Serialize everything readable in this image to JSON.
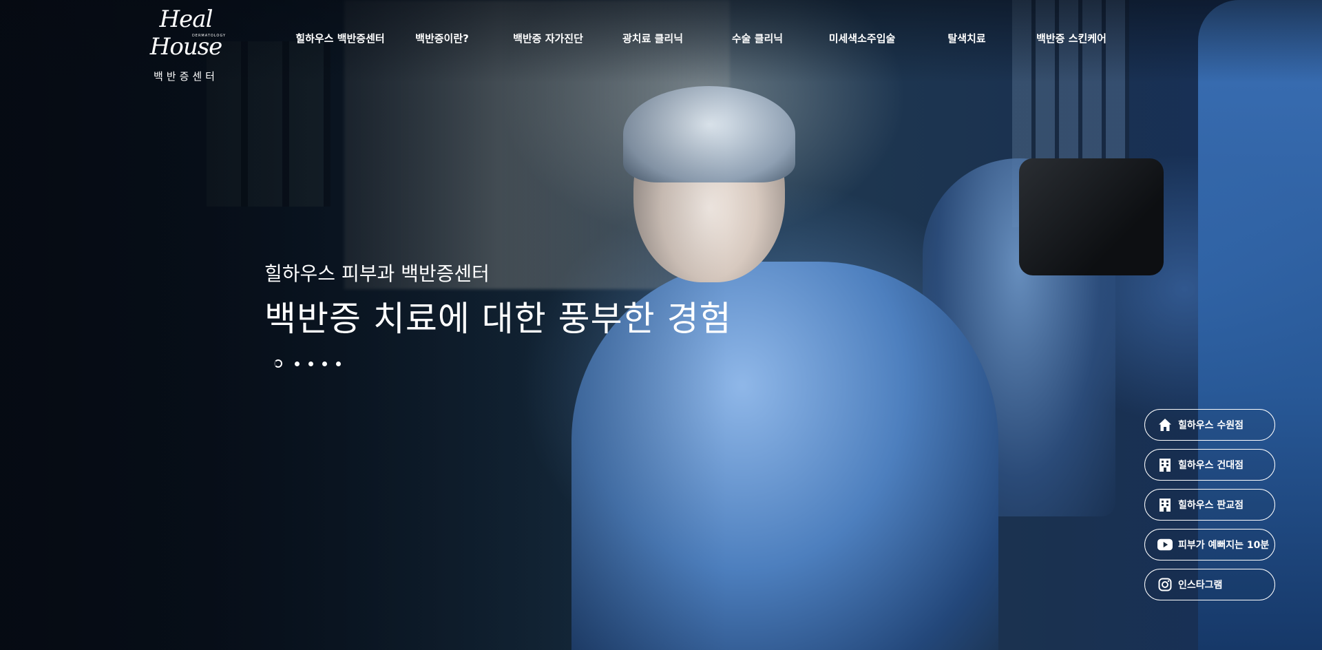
{
  "logo": {
    "script": "Heal House",
    "sub": "DERMATOLOGY",
    "korean": "백반증센터"
  },
  "nav": {
    "items": [
      {
        "label": "힐하우스 백반증센터"
      },
      {
        "label": "백반증이란?"
      },
      {
        "label": "백반증 자가진단"
      },
      {
        "label": "광치료 클리닉"
      },
      {
        "label": "수술 클리닉"
      },
      {
        "label": "미세색소주입술"
      },
      {
        "label": "탈색치료"
      },
      {
        "label": "백반증 스킨케어"
      }
    ]
  },
  "hero": {
    "subtitle": "힐하우스 피부과 백반증센터",
    "title": "백반증 치료에 대한 풍부한 경험",
    "slides_total": 5,
    "slide_active": 1
  },
  "quick_links": [
    {
      "label": "힐하우스 수원점",
      "icon": "home-icon"
    },
    {
      "label": "힐하우스 건대점",
      "icon": "building-icon"
    },
    {
      "label": "힐하우스 판교점",
      "icon": "building-icon"
    },
    {
      "label": "피부가 예뻐지는 10분",
      "icon": "youtube-icon"
    },
    {
      "label": "인스타그램",
      "icon": "instagram-icon"
    }
  ],
  "colors": {
    "text": "#ffffff",
    "button_border": "#ffffff"
  }
}
